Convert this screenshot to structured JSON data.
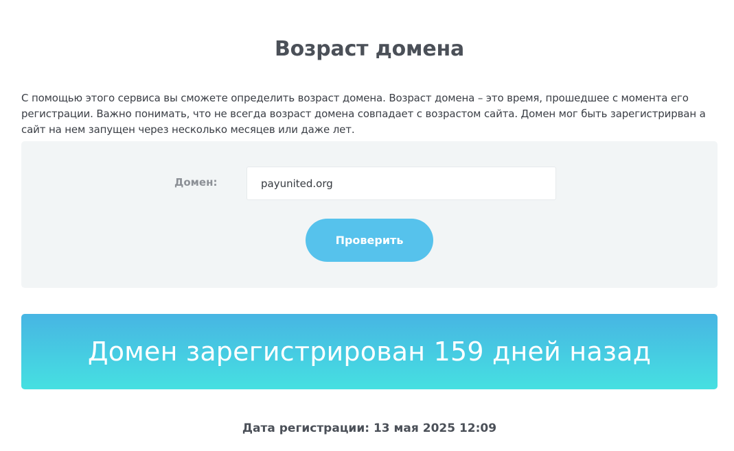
{
  "page": {
    "title": "Возраст домена",
    "intro": "С помощью этого сервиса вы сможете определить возраст домена. Возраст домена – это время, прошедшее с момента его регистрации. Важно понимать, что не всегда возраст домена совпадает с возрастом сайта. Домен мог быть зарегистрирван а сайт на нем запущен через несколько месяцев или даже лет."
  },
  "form": {
    "domain_label": "Домен:",
    "domain_value": "payunited.org",
    "submit_label": "Проверить"
  },
  "result": {
    "headline": "Домен зарегистрирован 159 дней назад",
    "registration_date": "Дата регистрации: 13 мая 2025 12:09"
  },
  "colors": {
    "button": "#56c2ec",
    "banner_top": "#47b5e3",
    "banner_bottom": "#46e0e1",
    "panel_bg": "#f2f5f6"
  }
}
